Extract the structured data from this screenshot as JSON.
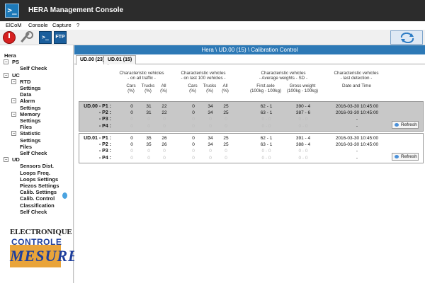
{
  "window": {
    "title": "HERA Management Console"
  },
  "menu": [
    "ElCoM",
    "Console",
    "Capture",
    "?"
  ],
  "toolbar": {
    "console_label": ">_",
    "ftp_label": "FTP"
  },
  "tree": [
    {
      "label": "Hera",
      "level": 0,
      "expander": ""
    },
    {
      "label": "PS",
      "level": 0,
      "expander": "−"
    },
    {
      "label": "Self Check",
      "level": 2,
      "expander": ""
    },
    {
      "label": "UC",
      "level": 0,
      "expander": "−"
    },
    {
      "label": "RTD",
      "level": 1,
      "expander": "−"
    },
    {
      "label": "Settings",
      "level": 2,
      "expander": ""
    },
    {
      "label": "Data",
      "level": 2,
      "expander": ""
    },
    {
      "label": "Alarm",
      "level": 1,
      "expander": "−"
    },
    {
      "label": "Settings",
      "level": 2,
      "expander": ""
    },
    {
      "label": "Memory",
      "level": 1,
      "expander": "−"
    },
    {
      "label": "Settings",
      "level": 2,
      "expander": ""
    },
    {
      "label": "Files",
      "level": 2,
      "expander": ""
    },
    {
      "label": "Statistic",
      "level": 1,
      "expander": "−"
    },
    {
      "label": "Settings",
      "level": 2,
      "expander": ""
    },
    {
      "label": "Files",
      "level": 2,
      "expander": ""
    },
    {
      "label": "Self Check",
      "level": 2,
      "expander": ""
    },
    {
      "label": "UD",
      "level": 0,
      "expander": "−"
    },
    {
      "label": "Sensors Dist.",
      "level": 2,
      "expander": ""
    },
    {
      "label": "Loops Freq.",
      "level": 2,
      "expander": ""
    },
    {
      "label": "Loops Settings",
      "level": 2,
      "expander": ""
    },
    {
      "label": "Piezos Settings",
      "level": 2,
      "expander": ""
    },
    {
      "label": "Calib. Settings",
      "level": 2,
      "expander": ""
    },
    {
      "label": "Calib. Control",
      "level": 2,
      "expander": ""
    },
    {
      "label": "Classification",
      "level": 2,
      "expander": ""
    },
    {
      "label": "Self Check",
      "level": 2,
      "expander": ""
    }
  ],
  "logo": {
    "line1": "ELECTRONIQUE",
    "line2": "CONTROLE",
    "line3": "MESURE"
  },
  "main": {
    "header": "Hera \\ UD.00  (15)  \\ Calibration Control",
    "tabs": [
      "UD.00 (23)",
      "UD.01 (15)"
    ],
    "active_tab": 0,
    "groups": [
      {
        "title": "Characteristic vehicles",
        "sub": "- on all traffic -",
        "cols": [
          "Cars\n(%)",
          "Trucks\n(%)",
          "All\n(%)"
        ]
      },
      {
        "title": "Characteristic vehicles",
        "sub": "- on last 100 vehicles -",
        "cols": [
          "Cars\n(%)",
          "Trucks\n(%)",
          "All\n(%)"
        ]
      },
      {
        "title": "Characteristic vehicles",
        "sub": "- Average weights - SD -",
        "cols": [
          "First axle\n(100kg - 100kg)",
          "Gross weight\n(100kg - 100kg)"
        ]
      },
      {
        "title": "Characteristic vehicles",
        "sub": "- last detection -",
        "cols": [
          "Date and Time"
        ]
      }
    ],
    "refresh_label": "Refresh",
    "blocks": [
      {
        "rows": [
          {
            "label": "UD.00 - P1 :",
            "dim": false,
            "all": [
              "0",
              "31",
              "22"
            ],
            "last100": [
              "0",
              "34",
              "25"
            ],
            "first_axle": "62 - 1",
            "gross": "390 - 4",
            "datetime": "2016-03-30 10:45:00"
          },
          {
            "label": "- P2 :",
            "dim": false,
            "all": [
              "0",
              "31",
              "22"
            ],
            "last100": [
              "0",
              "34",
              "25"
            ],
            "first_axle": "63 - 1",
            "gross": "387 - 6",
            "datetime": "2016-03-30 10:45:00"
          },
          {
            "label": "- P3 :",
            "dim": true,
            "all": [
              "0",
              "0",
              "0"
            ],
            "last100": [
              "0",
              "0",
              "0"
            ],
            "first_axle": "0 - 0",
            "gross": "0 - 0",
            "datetime": "-"
          },
          {
            "label": "- P4 :",
            "dim": true,
            "all": [
              "0",
              "0",
              "0"
            ],
            "last100": [
              "0",
              "0",
              "0"
            ],
            "first_axle": "0 - 0",
            "gross": "0 - 0",
            "datetime": "-"
          }
        ]
      },
      {
        "rows": [
          {
            "label": "UD.01 - P1 :",
            "dim": false,
            "all": [
              "0",
              "35",
              "26"
            ],
            "last100": [
              "0",
              "34",
              "25"
            ],
            "first_axle": "62 - 1",
            "gross": "391 - 4",
            "datetime": "2016-03-30 10:45:00"
          },
          {
            "label": "- P2 :",
            "dim": false,
            "all": [
              "0",
              "35",
              "26"
            ],
            "last100": [
              "0",
              "34",
              "25"
            ],
            "first_axle": "63 - 1",
            "gross": "388 - 4",
            "datetime": "2016-03-30 10:45:00"
          },
          {
            "label": "- P3 :",
            "dim": true,
            "all": [
              "0",
              "0",
              "0"
            ],
            "last100": [
              "0",
              "0",
              "0"
            ],
            "first_axle": "0 - 0",
            "gross": "0 - 0",
            "datetime": "-"
          },
          {
            "label": "- P4 :",
            "dim": true,
            "all": [
              "0",
              "0",
              "0"
            ],
            "last100": [
              "0",
              "0",
              "0"
            ],
            "first_axle": "0 - 0",
            "gross": "0 - 0",
            "datetime": "-"
          }
        ]
      }
    ]
  }
}
